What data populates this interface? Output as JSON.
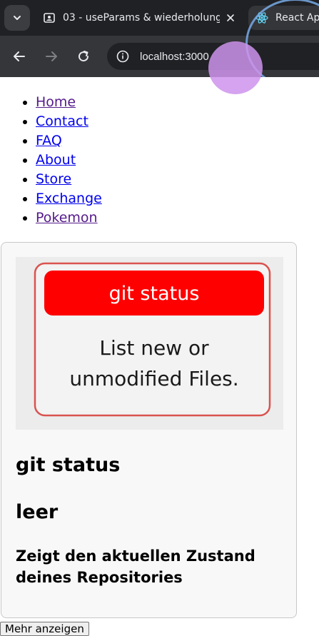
{
  "browser": {
    "tabs": [
      {
        "title": "03 - useParams & wiederholung",
        "active": false
      },
      {
        "title": "React App",
        "active": true
      }
    ],
    "url": "localhost:3000"
  },
  "nav": {
    "items": [
      {
        "label": "Home"
      },
      {
        "label": "Contact"
      },
      {
        "label": "FAQ"
      },
      {
        "label": "About"
      },
      {
        "label": "Store"
      },
      {
        "label": "Exchange"
      },
      {
        "label": "Pokemon"
      }
    ]
  },
  "card": {
    "image": {
      "banner_text": "git status",
      "line1": "List new or",
      "line2": "unmodified Files."
    },
    "title": "git status",
    "subtitle": "leer",
    "description": "Zeigt den aktuellen Zustand deines Repositories"
  },
  "more_button": {
    "label": "Mehr anzeigen"
  },
  "colors": {
    "link_visited": "#551a8b",
    "link_unvisited": "#0000ee",
    "banner_red": "#ff0000",
    "chrome_dark": "#202124"
  }
}
